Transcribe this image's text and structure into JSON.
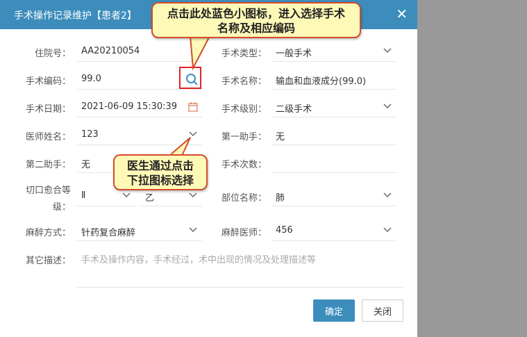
{
  "dialog": {
    "title": "手术操作记录维护【患者2】",
    "close_icon": "close-icon"
  },
  "form": {
    "admission_no": {
      "label": "住院号：",
      "value": "AA20210054"
    },
    "surgery_type": {
      "label": "手术类型：",
      "value": "一般手术"
    },
    "surgery_code": {
      "label": "手术编码：",
      "value": "99.0"
    },
    "surgery_name": {
      "label": "手术名称：",
      "value": "输血和血液成分(99.0)"
    },
    "surgery_date": {
      "label": "手术日期：",
      "value": "2021-06-09 15:30:39"
    },
    "surgery_level": {
      "label": "手术级别：",
      "value": "二级手术"
    },
    "doctor_name": {
      "label": "医师姓名：",
      "value": "123"
    },
    "first_assistant": {
      "label": "第一助手：",
      "value": "无"
    },
    "second_assistant": {
      "label": "第二助手：",
      "value": "无"
    },
    "surgery_count": {
      "label": "手术次数：",
      "value": ""
    },
    "incision_healing": {
      "label_line1": "切口愈合等",
      "label_line2": "级：",
      "value1": "Ⅱ",
      "value2": "乙"
    },
    "site_name": {
      "label": "部位名称：",
      "value": "肺"
    },
    "anesthesia_method": {
      "label": "麻醉方式：",
      "value": "针药复合麻醉"
    },
    "anesthesiologist": {
      "label": "麻醉医师：",
      "value": "456"
    },
    "other_desc": {
      "label": "其它描述：",
      "placeholder": "手术及操作内容，手术经过，术中出现的情况及处理描述等"
    }
  },
  "buttons": {
    "confirm": "确定",
    "close": "关闭"
  },
  "annotations": {
    "callout1_line1": "点击此处蓝色小图标，进入选择手术",
    "callout1_line2": "名称及相应编码",
    "callout2_line1": "医生通过点击",
    "callout2_line2": "下拉图标选择"
  },
  "colors": {
    "accent": "#3c8dbc",
    "callout_bg": "#fff9b8",
    "callout_border": "#d14b2a",
    "highlight": "#e02424"
  }
}
